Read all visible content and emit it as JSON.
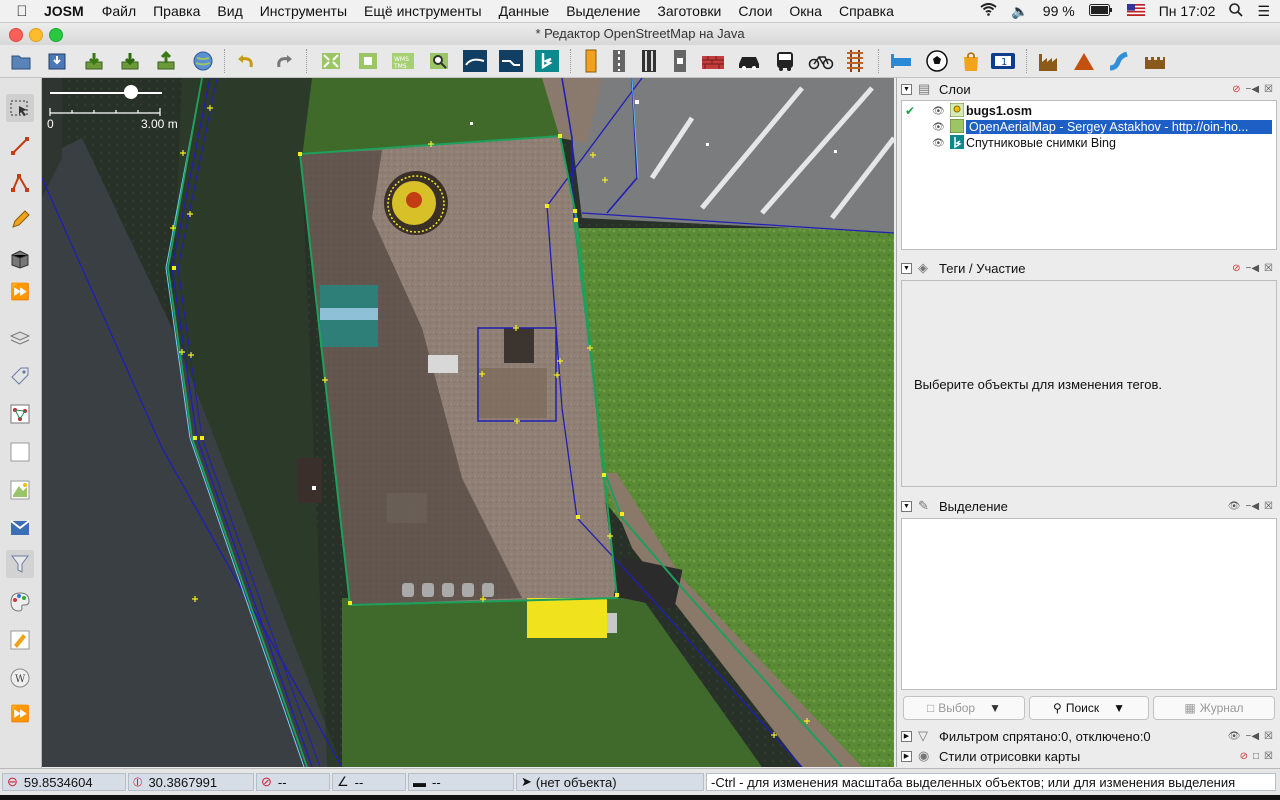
{
  "menubar": {
    "app": "JOSM",
    "items": [
      "Файл",
      "Правка",
      "Вид",
      "Инструменты",
      "Ещё инструменты",
      "Данные",
      "Выделение",
      "Заготовки",
      "Слои",
      "Окна",
      "Справка"
    ],
    "battery": "99 %",
    "clock": "Пн 17:02"
  },
  "window": {
    "title": "* Редактор OpenStreetMap на Java"
  },
  "map": {
    "scale_start": "0",
    "scale_end": "3.00 m"
  },
  "layers_panel": {
    "title": "Слои",
    "layers": [
      {
        "name": "bugs1.osm",
        "active": true
      },
      {
        "name": "OpenAerialMap - Sergey Astakhov - http://oin-ho...",
        "selected": true
      },
      {
        "name": "Спутниковые снимки Bing"
      }
    ]
  },
  "tags_panel": {
    "title": "Теги / Участие",
    "message": "Выберите объекты для изменения тегов."
  },
  "selection_panel": {
    "title": "Выделение",
    "buttons": {
      "select": "Выбор",
      "search": "Поиск",
      "history": "Журнал"
    }
  },
  "filter_panel": {
    "title": "Фильтром спрятано:0, отключено:0"
  },
  "styles_panel": {
    "title": "Стили отрисовки карты"
  },
  "statusbar": {
    "lat": "59.8534604",
    "lon": "30.3867991",
    "heading": "--",
    "angle": "--",
    "distance": "--",
    "object": "(нет объекта)",
    "help": "-Ctrl - для изменения масштаба выделенных объектов; или для изменения выделения"
  }
}
